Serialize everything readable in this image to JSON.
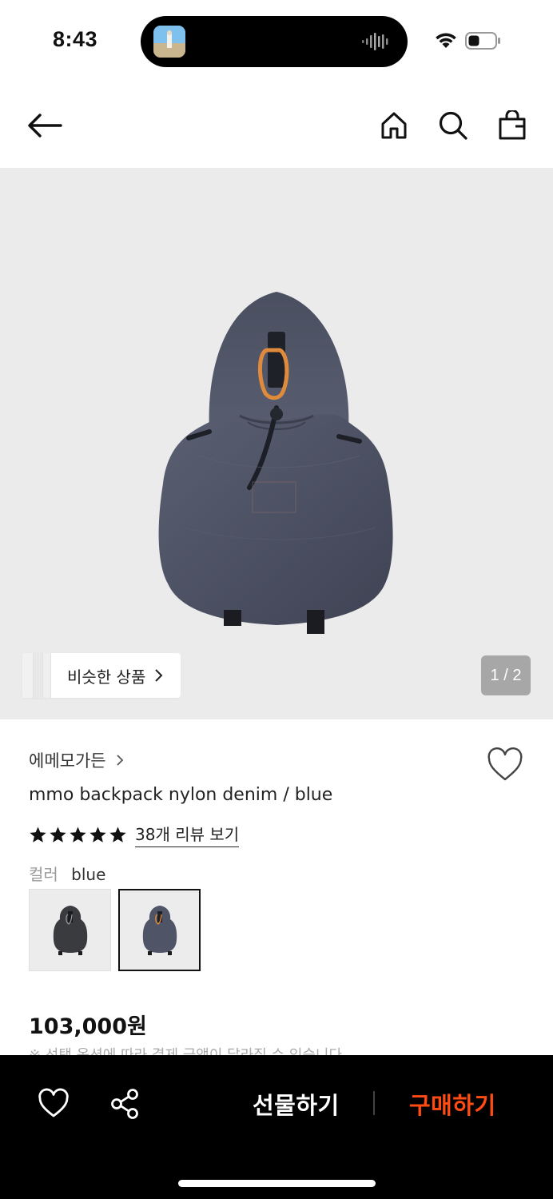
{
  "status_bar": {
    "time": "8:43"
  },
  "nav": {
    "icons": [
      "arrow-left-icon",
      "home-icon",
      "search-icon",
      "shopping-bag-icon"
    ]
  },
  "hero": {
    "similar_label": "비슷한 상품",
    "page_indicator": "1 / 2",
    "background_color": "#ebebeb"
  },
  "product": {
    "brand": "에메모가든",
    "name": "mmo backpack nylon denim / blue",
    "rating_stars": 5,
    "review_link": "38개 리뷰 보기",
    "option_label": "컬러",
    "option_value": "blue",
    "color_swatches": [
      "black",
      "blue"
    ],
    "selected_swatch": "blue",
    "price": "103,000원",
    "price_note": "※ 선택 옵션에 따라 결제 금액이 달라질 수 있습니다"
  },
  "bottom_bar": {
    "gift_label": "선물하기",
    "buy_label": "구매하기",
    "buy_color": "#ff4a12"
  }
}
